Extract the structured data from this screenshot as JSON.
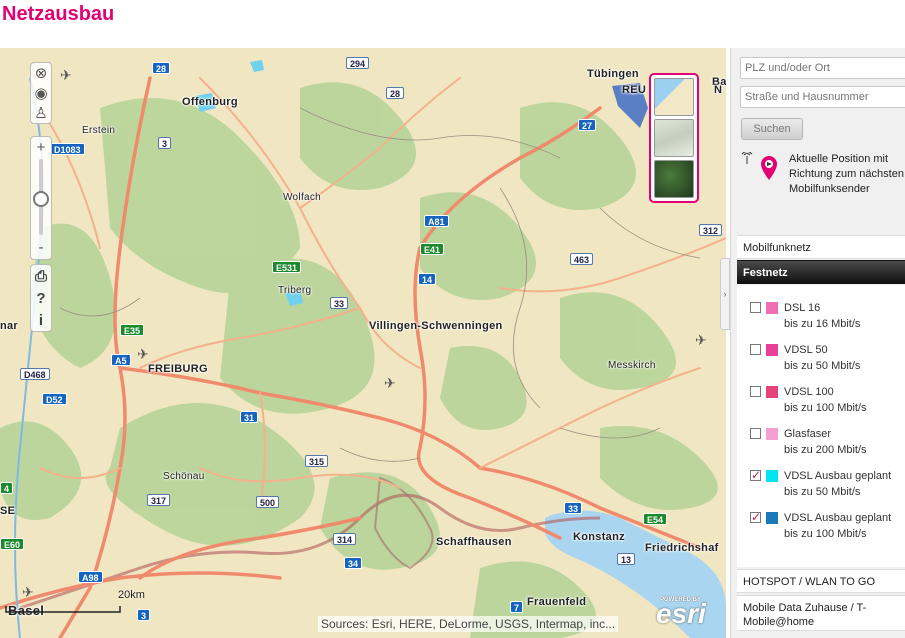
{
  "page": {
    "title": "Netzausbau"
  },
  "map": {
    "cities": [
      {
        "id": "tuebingen",
        "label": "Tübingen"
      },
      {
        "id": "offenburg",
        "label": "Offenburg"
      },
      {
        "id": "erstein",
        "label": "Erstein"
      },
      {
        "id": "wolfach",
        "label": "Wolfach"
      },
      {
        "id": "triberg",
        "label": "Triberg"
      },
      {
        "id": "villingen",
        "label": "Villingen-Schwenningen"
      },
      {
        "id": "freiburg",
        "label": "FREIBURG"
      },
      {
        "id": "messkirch",
        "label": "Messkirch"
      },
      {
        "id": "schoenau",
        "label": "Schönau"
      },
      {
        "id": "schaffhausen",
        "label": "Schaffhausen"
      },
      {
        "id": "konstanz",
        "label": "Konstanz"
      },
      {
        "id": "friedrichshafen",
        "label": "Friedrichshaf"
      },
      {
        "id": "frauenfeld",
        "label": "Frauenfeld"
      },
      {
        "id": "basel",
        "label": "Basel"
      },
      {
        "id": "nar",
        "label": "nar"
      },
      {
        "id": "se",
        "label": "SE"
      },
      {
        "id": "reu",
        "label": "REU"
      },
      {
        "id": "ba",
        "label": "Ba"
      },
      {
        "id": "n",
        "label": "N"
      }
    ],
    "shields": [
      {
        "id": "r28a",
        "label": "28",
        "style": "blue"
      },
      {
        "id": "r294",
        "label": "294",
        "style": "white"
      },
      {
        "id": "r28b",
        "label": "28",
        "style": "white"
      },
      {
        "id": "r27",
        "label": "27",
        "style": "blue"
      },
      {
        "id": "d1083",
        "label": "D1083",
        "style": "blue"
      },
      {
        "id": "r3a",
        "label": "3",
        "style": "white"
      },
      {
        "id": "a81",
        "label": "A81",
        "style": "blue"
      },
      {
        "id": "e41",
        "label": "E41",
        "style": "green"
      },
      {
        "id": "r312",
        "label": "312",
        "style": "white"
      },
      {
        "id": "e531",
        "label": "E531",
        "style": "green"
      },
      {
        "id": "r14",
        "label": "14",
        "style": "blue"
      },
      {
        "id": "r463",
        "label": "463",
        "style": "white"
      },
      {
        "id": "r33a",
        "label": "33",
        "style": "white"
      },
      {
        "id": "e35",
        "label": "E35",
        "style": "green"
      },
      {
        "id": "a5",
        "label": "A5",
        "style": "blue"
      },
      {
        "id": "d468",
        "label": "D468",
        "style": "white"
      },
      {
        "id": "d52",
        "label": "D52",
        "style": "blue"
      },
      {
        "id": "r31",
        "label": "31",
        "style": "blue"
      },
      {
        "id": "r315",
        "label": "315",
        "style": "white"
      },
      {
        "id": "r317",
        "label": "317",
        "style": "white"
      },
      {
        "id": "r500",
        "label": "500",
        "style": "white"
      },
      {
        "id": "r4",
        "label": "4",
        "style": "green"
      },
      {
        "id": "r33b",
        "label": "33",
        "style": "blue"
      },
      {
        "id": "e54",
        "label": "E54",
        "style": "green"
      },
      {
        "id": "r314",
        "label": "314",
        "style": "white"
      },
      {
        "id": "r34",
        "label": "34",
        "style": "blue"
      },
      {
        "id": "r13",
        "label": "13",
        "style": "white"
      },
      {
        "id": "e60",
        "label": "E60",
        "style": "green"
      },
      {
        "id": "a98",
        "label": "A98",
        "style": "blue"
      },
      {
        "id": "r3b",
        "label": "3",
        "style": "blue"
      },
      {
        "id": "r7",
        "label": "7",
        "style": "blue"
      }
    ],
    "scale_label": "20km",
    "attribution": "Sources: Esri, HERE, DeLorme, USGS, Intermap, inc...",
    "esri": {
      "powered": "POWERED BY",
      "logo": "esri"
    },
    "controls": {
      "zoom_in": "+",
      "zoom_out": "-",
      "zoom_level": 0.47,
      "info": "i",
      "help": "?"
    },
    "colors": {
      "lake": "#a9d5f0",
      "motorway": "#f08a6c",
      "forest": "#b9d59a",
      "land": "#f1e6c2"
    }
  },
  "sidebar": {
    "search": {
      "plz_placeholder": "PLZ und/oder Ort",
      "street_placeholder": "Straße und Hausnummer",
      "button": "Suchen"
    },
    "gps_text": "Aktuelle Position mit Richtung zum nächsten Mobilfunksender",
    "sections": {
      "mobilfunknetz": "Mobilfunknetz",
      "festnetz": "Festnetz",
      "hotspot": "HOTSPOT / WLAN TO GO",
      "mobile_data": "Mobile Data Zuhause / T-Mobile@home"
    },
    "festnetz_items": [
      {
        "label": "DSL 16",
        "sub": "bis zu 16 Mbit/s",
        "color": "#f06cb5",
        "checked": false
      },
      {
        "label": "VDSL 50",
        "sub": "bis zu 50 Mbit/s",
        "color": "#e8409a",
        "checked": false
      },
      {
        "label": "VDSL 100",
        "sub": "bis zu 100 Mbit/s",
        "color": "#e4427a",
        "checked": false
      },
      {
        "label": "Glasfaser",
        "sub": "bis zu 200 Mbit/s",
        "color": "#f4a1d2",
        "checked": false
      },
      {
        "label": "VDSL Ausbau geplant",
        "sub": "bis zu 50 Mbit/s",
        "color": "#00e5f0",
        "checked": true
      },
      {
        "label": "VDSL Ausbau geplant",
        "sub": "bis zu 100 Mbit/s",
        "color": "#1a7ab8",
        "checked": true
      }
    ]
  }
}
